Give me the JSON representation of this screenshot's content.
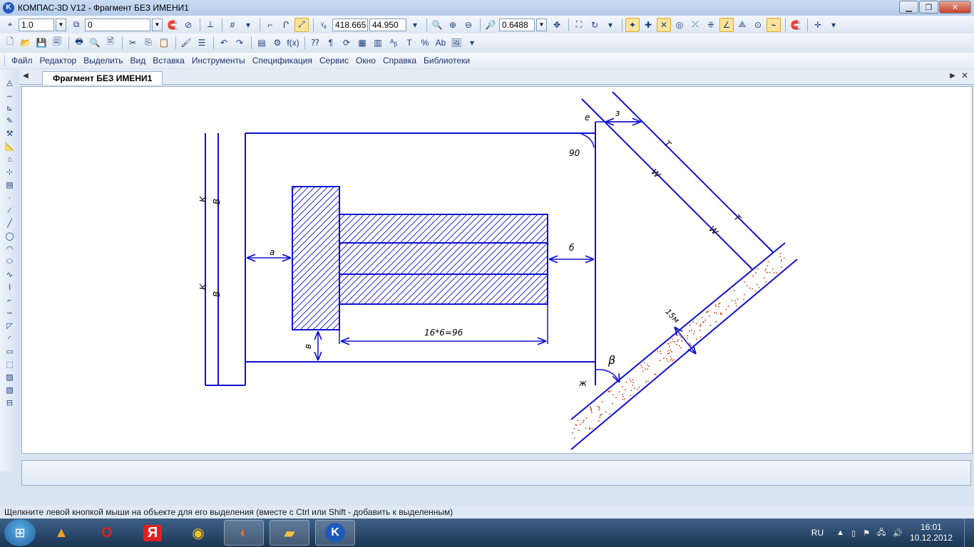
{
  "window": {
    "title": "КОМПАС-3D V12 - Фрагмент БЕЗ ИМЕНИ1",
    "app_icon": "K"
  },
  "toolbar1": {
    "line_scale": "1.0",
    "layer": "0",
    "coord_x": "418.665",
    "coord_y": "44.950",
    "zoom": "0.6488"
  },
  "toolbar2": {
    "fx_label": "f(x)",
    "text_label": "Ab"
  },
  "menu": {
    "items": [
      "Файл",
      "Редактор",
      "Выделить",
      "Вид",
      "Вставка",
      "Инструменты",
      "Спецификация",
      "Сервис",
      "Окно",
      "Справка",
      "Библиотеки"
    ]
  },
  "document_tab": {
    "label": "Фрагмент БЕЗ ИМЕНИ1"
  },
  "drawing": {
    "labels": {
      "k1": "К",
      "v1": "В",
      "k2": "К",
      "v2": "В",
      "a": "а",
      "b": "б",
      "v": "в",
      "e": "е",
      "z": "з",
      "t1": "Т",
      "w1": "W",
      "t2": "Т",
      "w2": "W",
      "angle": "90",
      "beta": "β",
      "zh": "ж",
      "dim_bottom": "16*6=96",
      "dim_15": "15м"
    },
    "colors": {
      "line": "#1010d0",
      "hatch": "#1010d0",
      "dots": "#c83c10"
    }
  },
  "status": {
    "text": "Щелкните левой кнопкой мыши на объекте для его выделения (вместе с Ctrl или Shift - добавить к выделенным)"
  },
  "taskbar": {
    "lang": "RU",
    "time": "16:01",
    "date": "10.12.2012"
  }
}
